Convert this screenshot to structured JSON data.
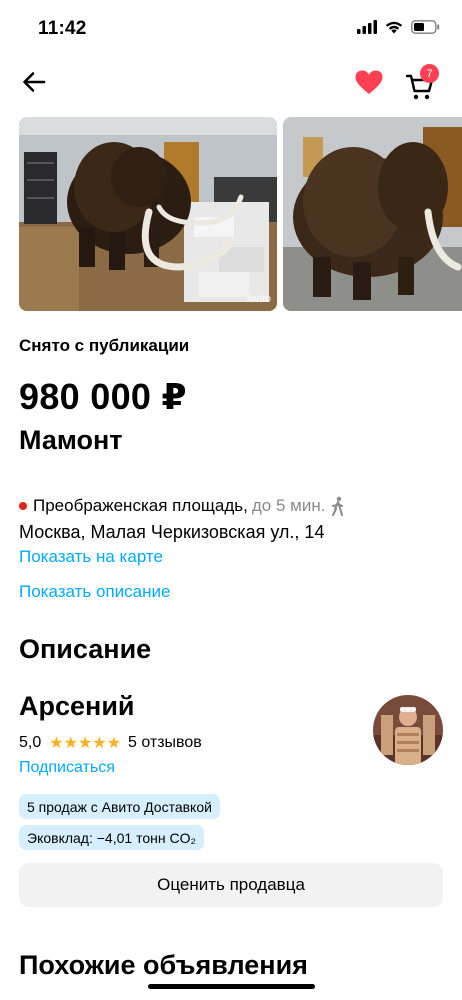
{
  "status_bar": {
    "time": "11:42"
  },
  "nav": {
    "cart_count": "7"
  },
  "gallery": {
    "watermark": "Avito"
  },
  "listing": {
    "status": "Снято с публикации",
    "price": "980 000 ₽",
    "title": "Мамонт",
    "metro_station": "Преображенская площадь,",
    "metro_time": "до 5 мин.",
    "address": "Москва, Малая Черкизовская ул., 14",
    "show_map": "Показать на карте",
    "show_description": "Показать описание"
  },
  "description": {
    "heading": "Описание"
  },
  "seller": {
    "name": "Арсений",
    "rating": "5,0",
    "stars": "★★★★★",
    "reviews": "5 отзывов",
    "subscribe": "Подписаться",
    "badge_delivery": "5 продаж с Авито Доставкой",
    "badge_eco": "Эковклад: −4,01 тонн CO₂",
    "rate_button": "Оценить продавца"
  },
  "similar": {
    "heading": "Похожие объявления"
  },
  "colors": {
    "accent_link": "#00aaff",
    "metro": "#e2231a",
    "heart": "#ff4053",
    "stars": "#ffb021",
    "chip_bg": "#d6efff"
  },
  "icons": [
    "back-arrow-icon",
    "heart-icon",
    "cart-icon",
    "walk-icon",
    "signal-icon",
    "wifi-icon",
    "battery-icon"
  ]
}
